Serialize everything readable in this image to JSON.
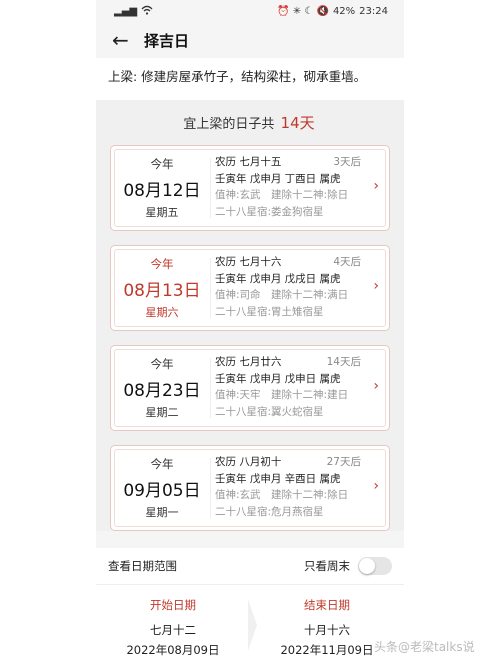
{
  "status": {
    "signal": "▂▄▆",
    "wifi": "wifi",
    "icons": "⏰ ✳ ☾ 🔇",
    "battery": "42%",
    "time": "23:24"
  },
  "nav": {
    "back": "←",
    "title": "择吉日"
  },
  "description": "上梁: 修建房屋承竹子，结构梁柱，砌承重墙。",
  "summary": {
    "prefix": "宜上梁的日子共",
    "count": "14天"
  },
  "cards": [
    {
      "year": "今年",
      "date": "08月12日",
      "weekday": "星期五",
      "lunar": "农历 七月十五",
      "after": "3天后",
      "ganzhi": "壬寅年 戊申月 丁酉日 属虎",
      "deity": "值神:玄武　建除十二神:除日",
      "mansion": "二十八星宿:娄金狗宿星"
    },
    {
      "year": "今年",
      "date": "08月13日",
      "weekday": "星期六",
      "lunar": "农历 七月十六",
      "after": "4天后",
      "ganzhi": "壬寅年 戊申月 戊戌日 属虎",
      "deity": "值神:司命　建除十二神:满日",
      "mansion": "二十八星宿:胃土雉宿星"
    },
    {
      "year": "今年",
      "date": "08月23日",
      "weekday": "星期二",
      "lunar": "农历 七月廿六",
      "after": "14天后",
      "ganzhi": "壬寅年 戊申月 戊申日 属虎",
      "deity": "值神:天牢　建除十二神:建日",
      "mansion": "二十八星宿:翼火蛇宿星"
    },
    {
      "year": "今年",
      "date": "09月05日",
      "weekday": "星期一",
      "lunar": "农历 八月初十",
      "after": "27天后",
      "ganzhi": "壬寅年 戊申月 辛酉日 属虎",
      "deity": "值神:玄武　建除十二神:除日",
      "mansion": "二十八星宿:危月燕宿星"
    }
  ],
  "chevron": "›",
  "bottom": {
    "range_label": "查看日期范围",
    "weekend_label": "只看周末",
    "weekend_only": false,
    "start": {
      "label": "开始日期",
      "lunar": "七月十二",
      "solar": "2022年08月09日"
    },
    "end": {
      "label": "结束日期",
      "lunar": "十月十六",
      "solar": "2022年11月09日"
    }
  },
  "watermark": "头条@老梁talks说",
  "colors": {
    "accent": "#c0392b",
    "card_border": "#e6c8c0",
    "background": "#f0f0f0"
  }
}
